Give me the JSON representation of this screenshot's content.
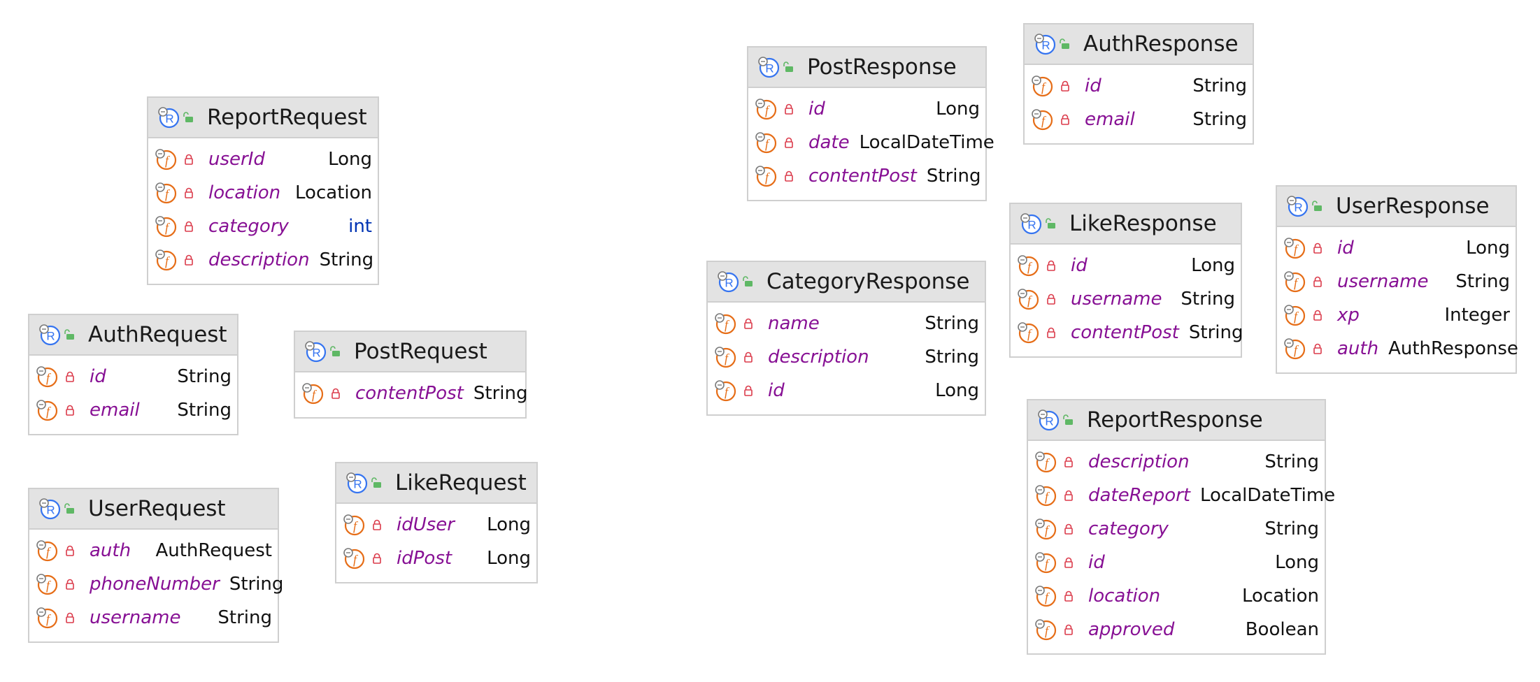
{
  "palette": {
    "record_icon": "#3574f0",
    "field_icon": "#e66d17",
    "lock_icon": "#db3b4b",
    "public_icon": "#5fb865",
    "field_name": "#871094",
    "primitive_type": "#0033b3",
    "header_bg": "#e3e3e3",
    "border": "#cfcfcf"
  },
  "icons": {
    "record": "record-icon",
    "field": "field-icon",
    "private": "lock-icon",
    "public": "open-lock-icon"
  },
  "classes": [
    {
      "name": "ReportRequest",
      "fields": [
        {
          "name": "userId",
          "type": "Long",
          "primitive": false
        },
        {
          "name": "location",
          "type": "Location",
          "primitive": false
        },
        {
          "name": "category",
          "type": "int",
          "primitive": true
        },
        {
          "name": "description",
          "type": "String",
          "primitive": false
        }
      ]
    },
    {
      "name": "AuthRequest",
      "fields": [
        {
          "name": "id",
          "type": "String",
          "primitive": false
        },
        {
          "name": "email",
          "type": "String",
          "primitive": false
        }
      ]
    },
    {
      "name": "PostRequest",
      "fields": [
        {
          "name": "contentPost",
          "type": "String",
          "primitive": false
        }
      ]
    },
    {
      "name": "UserRequest",
      "fields": [
        {
          "name": "auth",
          "type": "AuthRequest",
          "primitive": false
        },
        {
          "name": "phoneNumber",
          "type": "String",
          "primitive": false
        },
        {
          "name": "username",
          "type": "String",
          "primitive": false
        }
      ]
    },
    {
      "name": "LikeRequest",
      "fields": [
        {
          "name": "idUser",
          "type": "Long",
          "primitive": false
        },
        {
          "name": "idPost",
          "type": "Long",
          "primitive": false
        }
      ]
    },
    {
      "name": "PostResponse",
      "fields": [
        {
          "name": "id",
          "type": "Long",
          "primitive": false
        },
        {
          "name": "date",
          "type": "LocalDateTime",
          "primitive": false
        },
        {
          "name": "contentPost",
          "type": "String",
          "primitive": false
        }
      ]
    },
    {
      "name": "AuthResponse",
      "fields": [
        {
          "name": "id",
          "type": "String",
          "primitive": false
        },
        {
          "name": "email",
          "type": "String",
          "primitive": false
        }
      ]
    },
    {
      "name": "CategoryResponse",
      "fields": [
        {
          "name": "name",
          "type": "String",
          "primitive": false
        },
        {
          "name": "description",
          "type": "String",
          "primitive": false
        },
        {
          "name": "id",
          "type": "Long",
          "primitive": false
        }
      ]
    },
    {
      "name": "LikeResponse",
      "fields": [
        {
          "name": "id",
          "type": "Long",
          "primitive": false
        },
        {
          "name": "username",
          "type": "String",
          "primitive": false
        },
        {
          "name": "contentPost",
          "type": "String",
          "primitive": false
        }
      ]
    },
    {
      "name": "UserResponse",
      "fields": [
        {
          "name": "id",
          "type": "Long",
          "primitive": false
        },
        {
          "name": "username",
          "type": "String",
          "primitive": false
        },
        {
          "name": "xp",
          "type": "Integer",
          "primitive": false
        },
        {
          "name": "auth",
          "type": "AuthResponse",
          "primitive": false
        }
      ]
    },
    {
      "name": "ReportResponse",
      "fields": [
        {
          "name": "description",
          "type": "String",
          "primitive": false
        },
        {
          "name": "dateReport",
          "type": "LocalDateTime",
          "primitive": false
        },
        {
          "name": "category",
          "type": "String",
          "primitive": false
        },
        {
          "name": "id",
          "type": "Long",
          "primitive": false
        },
        {
          "name": "location",
          "type": "Location",
          "primitive": false
        },
        {
          "name": "approved",
          "type": "Boolean",
          "primitive": false
        }
      ]
    }
  ]
}
